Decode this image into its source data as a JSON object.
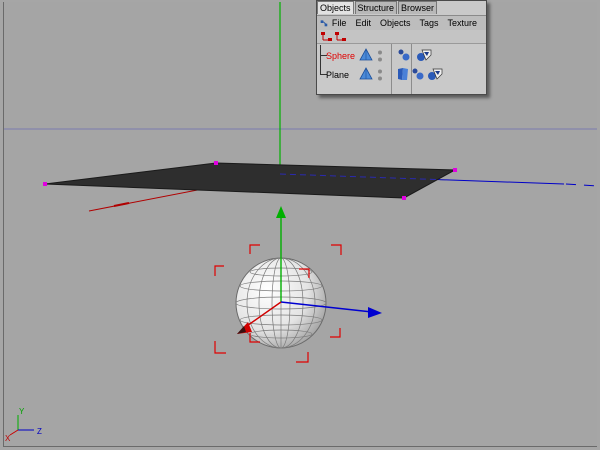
{
  "object_manager": {
    "tabs": [
      {
        "label": "Objects",
        "active": true
      },
      {
        "label": "Structure",
        "active": false
      },
      {
        "label": "Browser",
        "active": false
      }
    ],
    "menu": [
      "File",
      "Edit",
      "Objects",
      "Tags",
      "Texture"
    ],
    "objects": [
      {
        "name": "Sphere",
        "selected": true,
        "tags": [
          "phong-tag-icon",
          "texture-tag-icon"
        ]
      },
      {
        "name": "Plane",
        "selected": false,
        "tags": [
          "uvw-tag-icon",
          "phong-tag-icon",
          "texture-tag-icon"
        ]
      }
    ]
  },
  "axis_colors": {
    "x": "#d00000",
    "y": "#00b000",
    "z": "#0000d0"
  },
  "selection_color": "#e00000"
}
